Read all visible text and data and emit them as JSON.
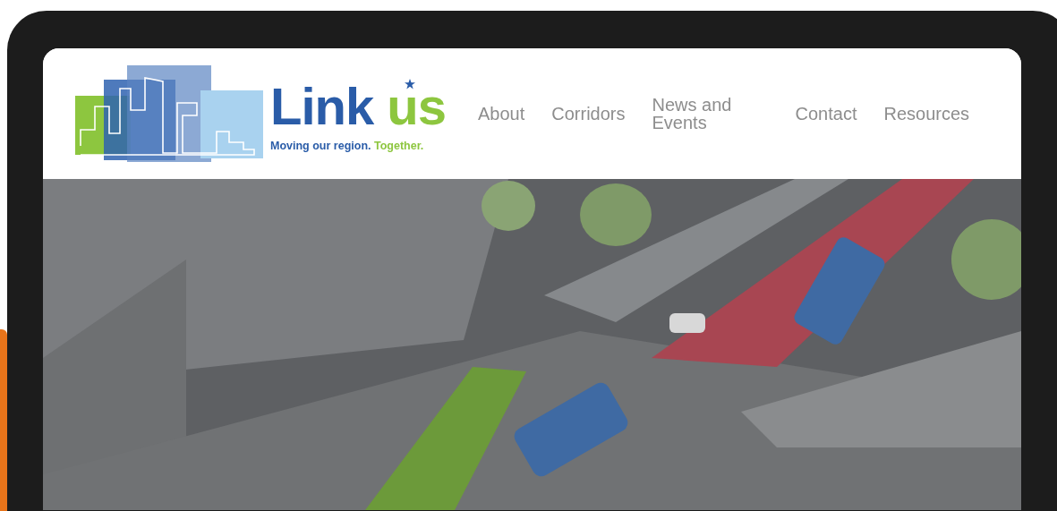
{
  "logo": {
    "name": "Link",
    "name_accent": "us",
    "tagline": "Moving our region.",
    "tagline_accent": "Together."
  },
  "nav": [
    {
      "label": "About"
    },
    {
      "label": "Corridors"
    },
    {
      "label": "News and Events"
    },
    {
      "label": "Contact"
    },
    {
      "label": "Resources"
    }
  ]
}
